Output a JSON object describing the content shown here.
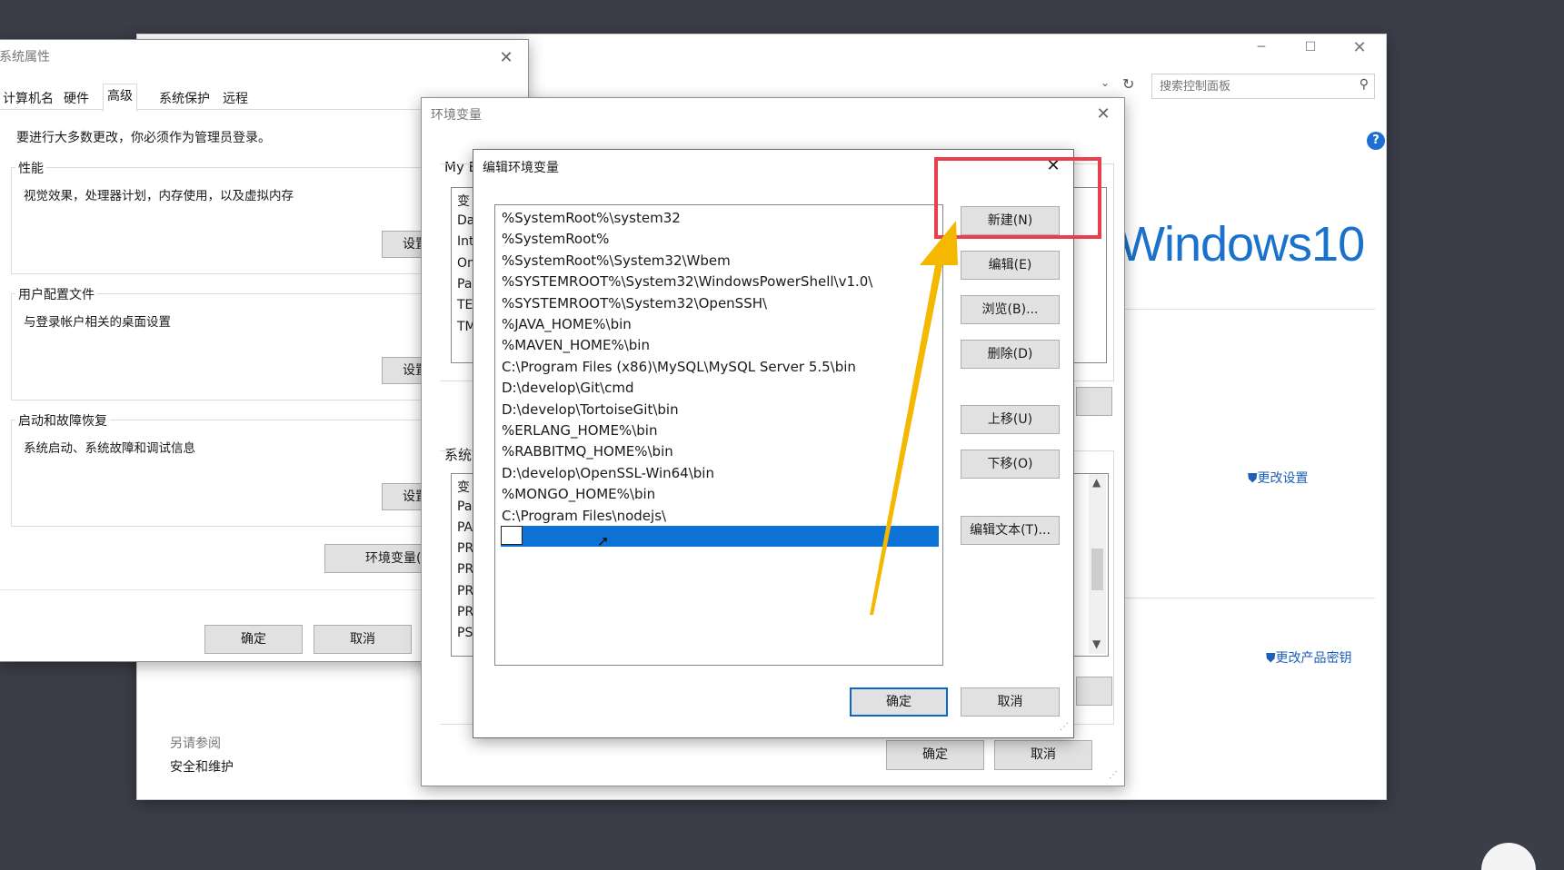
{
  "control_panel": {
    "search_placeholder": "搜索控制面板",
    "windows_logo": "Windows10",
    "change_settings": "更改设置",
    "change_product_key": "更改产品密钥",
    "see_also": "另请参阅",
    "security_maintenance": "安全和维护"
  },
  "system_props": {
    "title": "系统属性",
    "tabs": [
      "计算机名",
      "硬件",
      "高级",
      "系统保护",
      "远程"
    ],
    "admin_notice": "要进行大多数更改，你必须作为管理员登录。",
    "performance": {
      "label": "性能",
      "desc": "视觉效果，处理器计划，内存使用，以及虚拟内存",
      "button": "设置(S)..."
    },
    "user_profile": {
      "label": "用户配置文件",
      "desc": "与登录帐户相关的桌面设置",
      "button": "设置(E)..."
    },
    "startup": {
      "label": "启动和故障恢复",
      "desc": "系统启动、系统故障和调试信息",
      "button": "设置(T)..."
    },
    "env_button": "环境变量(N)...",
    "ok": "确定",
    "cancel": "取消"
  },
  "env_vars": {
    "title": "环境变量",
    "user_section": "My Bo",
    "user_col_prefix": "变",
    "user_rows": [
      "Da",
      "Int",
      "On",
      "Pa",
      "TE",
      "TM"
    ],
    "system_section": "系统",
    "system_col_prefix": "变",
    "system_rows": [
      "Pa",
      "PA",
      "PR",
      "PR",
      "PR",
      "PR",
      "PS"
    ],
    "ok": "确定",
    "cancel": "取消"
  },
  "edit_env": {
    "title": "编辑环境变量",
    "paths": [
      "%SystemRoot%\\system32",
      "%SystemRoot%",
      "%SystemRoot%\\System32\\Wbem",
      "%SYSTEMROOT%\\System32\\WindowsPowerShell\\v1.0\\",
      "%SYSTEMROOT%\\System32\\OpenSSH\\",
      "%JAVA_HOME%\\bin",
      "%MAVEN_HOME%\\bin",
      "C:\\Program Files (x86)\\MySQL\\MySQL Server 5.5\\bin",
      "D:\\develop\\Git\\cmd",
      "D:\\develop\\TortoiseGit\\bin",
      "%ERLANG_HOME%\\bin",
      "%RABBITMQ_HOME%\\bin",
      "D:\\develop\\OpenSSL-Win64\\bin",
      "%MONGO_HOME%\\bin",
      "C:\\Program Files\\nodejs\\"
    ],
    "new_entry_value": "",
    "buttons": {
      "new": "新建(N)",
      "edit": "编辑(E)",
      "browse": "浏览(B)...",
      "delete": "删除(D)",
      "move_up": "上移(U)",
      "move_down": "下移(O)",
      "edit_text": "编辑文本(T)..."
    },
    "ok": "确定",
    "cancel": "取消"
  },
  "annotation": {
    "highlight_color": "#e8404a",
    "arrow_color": "#f5b800"
  }
}
